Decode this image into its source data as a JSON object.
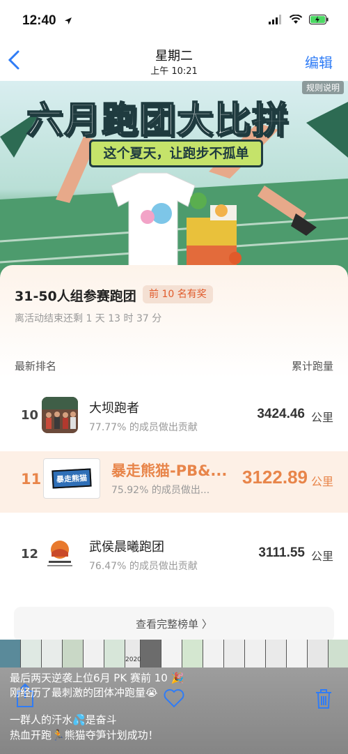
{
  "status_bar": {
    "time": "12:40"
  },
  "nav": {
    "title": "星期二",
    "subtitle": "上午 10:21",
    "edit_label": "编辑"
  },
  "banner": {
    "title": "六月跑团大比拼",
    "slogan": "这个夏天，让跑步不孤单",
    "rules_label": "规则说明"
  },
  "group": {
    "title": "31-50人组参赛跑团",
    "badge": "前 10 名有奖",
    "countdown": "离活动结束还剩 1 天 13 时 37 分"
  },
  "ranking": {
    "rank_header": "最新排名",
    "distance_header": "累计跑量",
    "rows": [
      {
        "rank": "10",
        "name": "大坝跑者",
        "contribution": "77.77% 的成员做出贡献",
        "distance": "3424.46",
        "unit": "公里"
      },
      {
        "rank": "11",
        "name": "暴走熊猫-PB&...",
        "contribution": "75.92% 的成员做出...",
        "distance": "3122.89",
        "unit": "公里",
        "avatar_text": "暴走熊猫"
      },
      {
        "rank": "12",
        "name": "武侯晨曦跑团",
        "contribution": "76.47% 的成员做出贡献",
        "distance": "3111.55",
        "unit": "公里"
      }
    ],
    "view_full_label": "查看完整榜单 〉"
  },
  "filmstrip": {
    "year_label": "2020"
  },
  "caption": {
    "line1": "最后两天逆袭上位6月 PK 赛前 10 🎉",
    "line2": "刚经历了最刺激的团体冲跑量😭",
    "line3": "一群人的汗水💦是奋斗",
    "line4": "热血开跑🏃熊猫夺笋计划成功！"
  },
  "colors": {
    "accent": "#e8854a",
    "link": "#2f7cf6",
    "banner_green": "#4b9a6c"
  },
  "icons": [
    "location-arrow-icon",
    "signal-icon",
    "wifi-icon",
    "battery-icon",
    "back-chevron-icon",
    "share-icon",
    "heart-icon",
    "trash-icon"
  ]
}
